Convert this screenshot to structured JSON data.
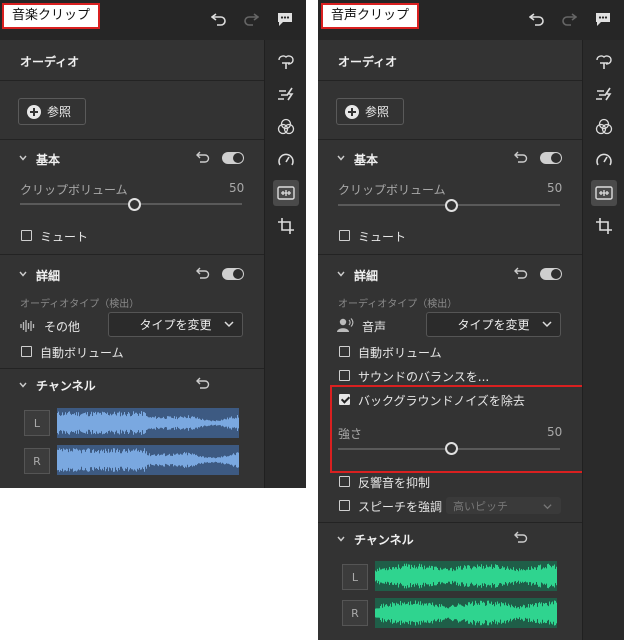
{
  "colors": {
    "music_wave": "#7aa8e0",
    "music_wave_bg": "#3d5a82",
    "voice_wave": "#2fd48f",
    "voice_wave_bg": "#1f5e48",
    "highlight": "#d92020"
  },
  "music": {
    "title": "音楽クリップ",
    "section_title": "オーディオ",
    "browse_label": "参照",
    "basic": {
      "label": "基本",
      "volume_label": "クリップボリューム",
      "volume_value": "50",
      "volume_level": 0.5,
      "mute_label": "ミュート",
      "mute_checked": false,
      "enabled": true
    },
    "details": {
      "label": "詳細",
      "type_label": "オーディオタイプ（検出）",
      "type_value": "その他",
      "change_type": "タイプを変更",
      "auto_volume": "自動ボリューム",
      "auto_volume_checked": false,
      "enabled": true
    },
    "channels": {
      "label": "チャンネル",
      "left": "L",
      "right": "R"
    }
  },
  "voice": {
    "title": "音声クリップ",
    "section_title": "オーディオ",
    "browse_label": "参照",
    "basic": {
      "label": "基本",
      "volume_label": "クリップボリューム",
      "volume_value": "50",
      "volume_level": 0.5,
      "mute_label": "ミュート",
      "mute_checked": false,
      "enabled": true
    },
    "details": {
      "label": "詳細",
      "type_label": "オーディオタイプ（検出）",
      "type_value": "音声",
      "change_type": "タイプを変更",
      "auto_volume": "自動ボリューム",
      "auto_volume_checked": false,
      "balance": "サウンドのバランスを...",
      "balance_checked": false,
      "noise_removal": "バックグラウンドノイズを除去",
      "noise_removal_checked": true,
      "strength_label": "強さ",
      "strength_value": "50",
      "strength_level": 0.5,
      "reverb": "反響音を抑制",
      "reverb_checked": false,
      "speech": "スピーチを強調",
      "speech_checked": false,
      "pitch": "高いピッチ",
      "enabled": true
    },
    "channels": {
      "label": "チャンネル",
      "left": "L",
      "right": "R"
    }
  },
  "icons": {
    "header": [
      "undo-icon",
      "redo-icon",
      "comment-icon"
    ],
    "rail": [
      "text-icon",
      "speed-lines-icon",
      "color-circles-icon",
      "gauge-icon",
      "audio-icon",
      "crop-icon"
    ]
  }
}
